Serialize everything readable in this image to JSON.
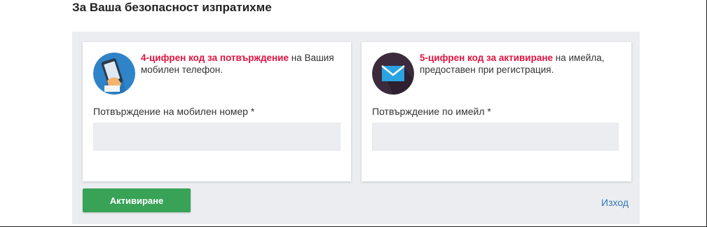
{
  "heading": "За Ваша безопасност изпратихме",
  "phone_card": {
    "highlight": "4-цифрен код за потвърждение",
    "description": " на Вашия мобилен телефон.",
    "field_label": "Потвърждение на мобилен номер *",
    "field_value": "",
    "icon": "phone-in-hand-icon"
  },
  "email_card": {
    "highlight": "5-цифрен код за активиране",
    "description": " на имейла, предоставен при регистрация.",
    "field_label": "Потвърждение по имейл *",
    "field_value": "",
    "icon": "envelope-icon"
  },
  "actions": {
    "submit_label": "Активиране",
    "logout_label": "Изход"
  },
  "colors": {
    "highlight": "#e0123f",
    "button": "#38a257",
    "link": "#3a76b8",
    "panel": "#ebedf1"
  }
}
